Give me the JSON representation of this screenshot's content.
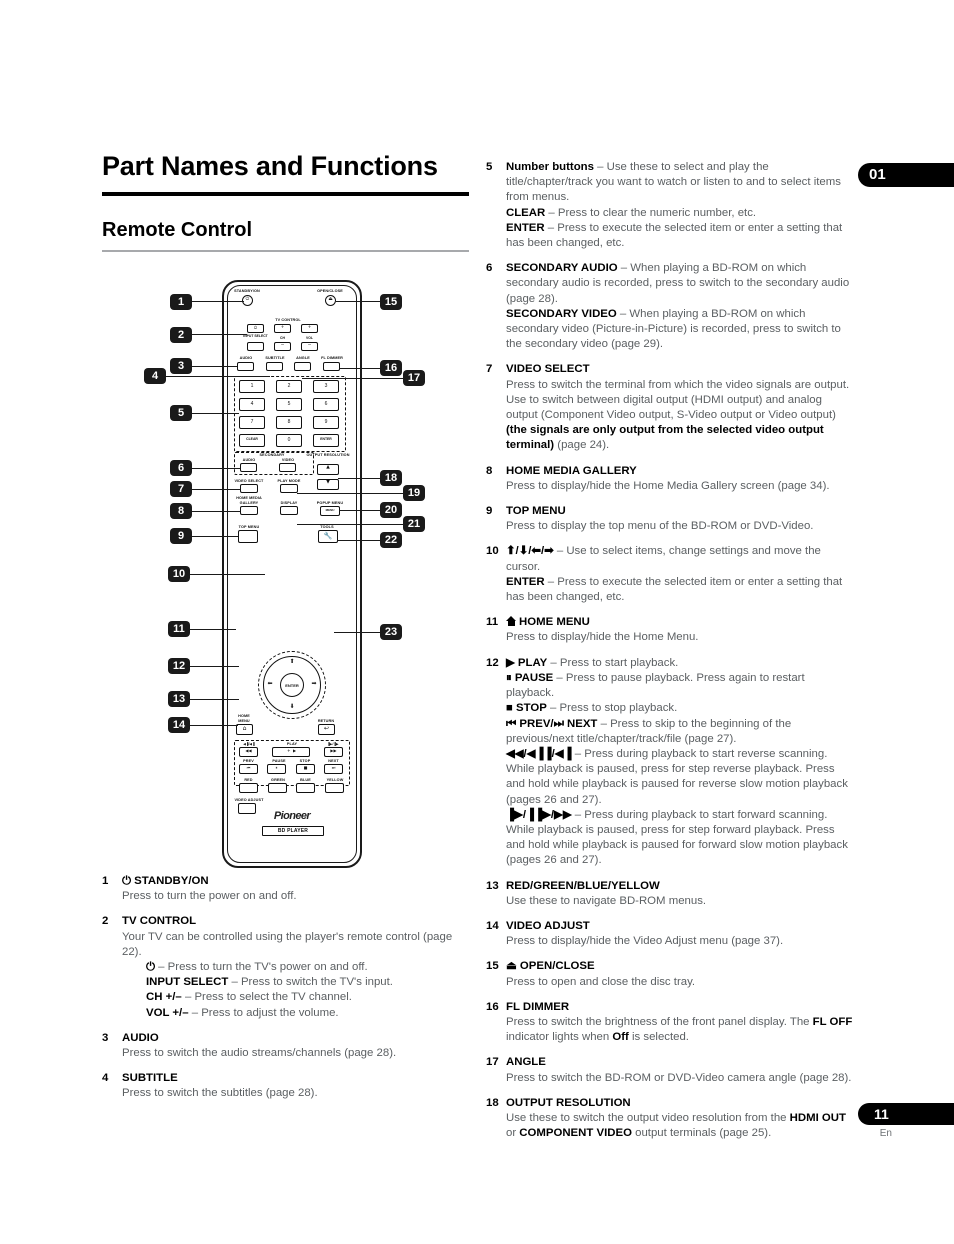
{
  "page_title": "Part Names and Functions",
  "section_title": "Remote Control",
  "chapter_badge": "01",
  "page_number": "11",
  "page_language": "En",
  "left_column": [
    {
      "num": "1",
      "head": "⏻ STANDBY/ON",
      "lines": [
        {
          "text": "Press to turn the power on and off."
        }
      ]
    },
    {
      "num": "2",
      "head": "TV CONTROL",
      "lines": [
        {
          "text": "Your TV can be controlled using the player's remote control (page 22)."
        },
        {
          "indent": true,
          "gap": true,
          "bold": "⏻",
          "text": " – Press to turn the TV's power on and off."
        },
        {
          "indent": true,
          "gap": true,
          "bold": "INPUT SELECT",
          "text": " – Press to switch the TV's input."
        },
        {
          "indent": true,
          "gap": true,
          "bold": "CH +/–",
          "text": " – Press to select the TV channel."
        },
        {
          "indent": true,
          "gap": true,
          "bold": "VOL +/–",
          "text": " – Press to adjust the volume."
        }
      ]
    },
    {
      "num": "3",
      "head": "AUDIO",
      "lines": [
        {
          "text": "Press to switch the audio streams/channels (page 28)."
        }
      ]
    },
    {
      "num": "4",
      "head": "SUBTITLE",
      "lines": [
        {
          "text": "Press to switch the subtitles (page 28)."
        }
      ]
    }
  ],
  "right_column": [
    {
      "num": "5",
      "inline_head": "Number buttons",
      "lines": [
        {
          "bold": "Number buttons",
          "text": " – Use these to select and play the title/chapter/track you want to watch or listen to and to select items from menus."
        },
        {
          "bold": "CLEAR",
          "text": " – Press to clear the numeric number, etc."
        },
        {
          "bold": "ENTER",
          "gap": true,
          "text": " – Press to execute the selected item or enter a setting that has been changed, etc."
        }
      ]
    },
    {
      "num": "6",
      "inline_head": "SECONDARY AUDIO",
      "lines": [
        {
          "bold": "SECONDARY AUDIO",
          "text": " – When playing a BD-ROM on which secondary audio is recorded, press to switch to the secondary audio (page 28)."
        },
        {
          "bold": "SECONDARY VIDEO",
          "text": " – When playing a BD-ROM on which secondary video (Picture-in-Picture) is recorded, press to switch to the secondary video (page 29)."
        }
      ]
    },
    {
      "num": "7",
      "head": "VIDEO SELECT",
      "lines": [
        {
          "text": "Press to switch the terminal from which the video signals are output. Use to switch between digital output (HDMI output) and analog output (Component Video output, S-Video output or Video output) ",
          "bold_after": "(the signals are only output from the selected video output terminal)",
          "tail": " (page 24)."
        }
      ]
    },
    {
      "num": "8",
      "head": "HOME MEDIA GALLERY",
      "lines": [
        {
          "text": "Press to display/hide the Home Media Gallery screen (page 34)."
        }
      ]
    },
    {
      "num": "9",
      "head": "TOP MENU",
      "lines": [
        {
          "text": "Press to display the top menu of the BD-ROM or DVD-Video."
        }
      ]
    },
    {
      "num": "10",
      "inline_head": "⬆/⬇/⬅/➡",
      "lines": [
        {
          "bold": "⬆/⬇/⬅/➡",
          "text": " – Use to select items, change settings and move the cursor."
        },
        {
          "bold": "ENTER",
          "text": " – Press to execute the selected item or enter a setting that has been changed, etc."
        }
      ]
    },
    {
      "num": "11",
      "head": "HOME MENU",
      "home_icon": true,
      "lines": [
        {
          "text": "Press to display/hide the Home Menu."
        }
      ]
    },
    {
      "num": "12",
      "inline_head": "▶ PLAY",
      "lines": [
        {
          "bold": "▶ PLAY",
          "text": " – Press to start playback."
        },
        {
          "bold": "⏸ PAUSE",
          "text": " – Press to pause playback. Press again to restart playback."
        },
        {
          "bold": "■ STOP",
          "gap": true,
          "text": " – Press to stop playback."
        },
        {
          "bold": "⏮ PREV/⏭ NEXT",
          "gap": true,
          "text": " – Press to skip to the beginning of the previous/next title/chapter/track/file (page 27)."
        },
        {
          "bold": "◀◀/◀▐▐/◀▐",
          "gap": true,
          "text": " – Press during playback to start reverse scanning. While playback is paused, press for step reverse playback. Press and hold while playback is paused for reverse slow motion playback (pages 26 and 27)."
        },
        {
          "bold": "▐▶/▐▐▶/▶▶",
          "gap": true,
          "text": " – Press during playback to start forward scanning. While playback is paused, press for step forward playback. Press and hold while playback is paused for forward slow motion playback (pages 26 and 27)."
        }
      ]
    },
    {
      "num": "13",
      "head": "RED/GREEN/BLUE/YELLOW",
      "lines": [
        {
          "text": "Use these to navigate BD-ROM menus."
        }
      ]
    },
    {
      "num": "14",
      "head": "VIDEO ADJUST",
      "lines": [
        {
          "text": "Press to display/hide the Video Adjust menu (page 37)."
        }
      ]
    },
    {
      "num": "15",
      "head": "⏏ OPEN/CLOSE",
      "lines": [
        {
          "text": "Press to open and close the disc tray."
        }
      ]
    },
    {
      "num": "16",
      "head": "FL DIMMER",
      "lines": [
        {
          "text": "Press to switch the brightness of the front panel display. The ",
          "bold_after": "FL OFF",
          "tail": " indicator lights when ",
          "bold_after2": "Off",
          "tail2": " is selected."
        }
      ]
    },
    {
      "num": "17",
      "head": "ANGLE",
      "lines": [
        {
          "text": "Press to switch the BD-ROM or DVD-Video camera angle (page 28)."
        }
      ]
    },
    {
      "num": "18",
      "head": "OUTPUT RESOLUTION",
      "lines": [
        {
          "text": "Use these to switch the output video resolution from the ",
          "bold_after": "HDMI OUT",
          "tail": " or ",
          "bold_after2": "COMPONENT VIDEO",
          "tail2": " output terminals (page 25)."
        }
      ]
    }
  ],
  "remote": {
    "brand": "Pioneer",
    "brand_sub": "BD PLAYER",
    "labels": {
      "standby_on": "STANDBY/ON",
      "open_close": "OPEN/CLOSE",
      "tv_control": "TV CONTROL",
      "input_select": "INPUT SELECT",
      "ch": "CH",
      "vol": "VOL",
      "audio": "AUDIO",
      "subtitle": "SUBTITLE",
      "angle": "ANGLE",
      "fl_dimmer": "FL DIMMER",
      "clear": "CLEAR",
      "enter": "ENTER",
      "secondary": "SECONDARY",
      "sec_audio": "AUDIO",
      "sec_video": "VIDEO",
      "output_resolution": "OUTPUT RESOLUTION",
      "video_select": "VIDEO SELECT",
      "play_mode": "PLAY MODE",
      "home_media_gallery_1": "HOME MEDIA",
      "home_media_gallery_2": "GALLERY",
      "display": "DISPLAY",
      "popup_menu": "POPUP MENU",
      "menu_btn": "MENU",
      "top_menu": "TOP MENU",
      "tools": "TOOLS",
      "home_menu_1": "HOME",
      "home_menu_2": "MENU",
      "return": "RETURN",
      "enter_pad": "ENTER",
      "play": "PLAY",
      "prev": "PREV",
      "pause": "PAUSE",
      "stop": "STOP",
      "next": "NEXT",
      "scan_rev": "◀▐/◀▐",
      "scan_fwd": "▐▶/▐▶",
      "red": "RED",
      "green": "GREEN",
      "blue": "BLUE",
      "yellow": "YELLOW",
      "video_adjust": "VIDEO ADJUST"
    },
    "keypad": [
      "1",
      "2",
      "3",
      "4",
      "5",
      "6",
      "7",
      "8",
      "9"
    ],
    "zero": "0"
  },
  "callouts_left": [
    "1",
    "2",
    "3",
    "4",
    "5",
    "6",
    "7",
    "8",
    "9",
    "10",
    "11",
    "12",
    "13",
    "14"
  ],
  "callouts_right": [
    "15",
    "16",
    "17",
    "18",
    "19",
    "20",
    "21",
    "22",
    "23"
  ]
}
